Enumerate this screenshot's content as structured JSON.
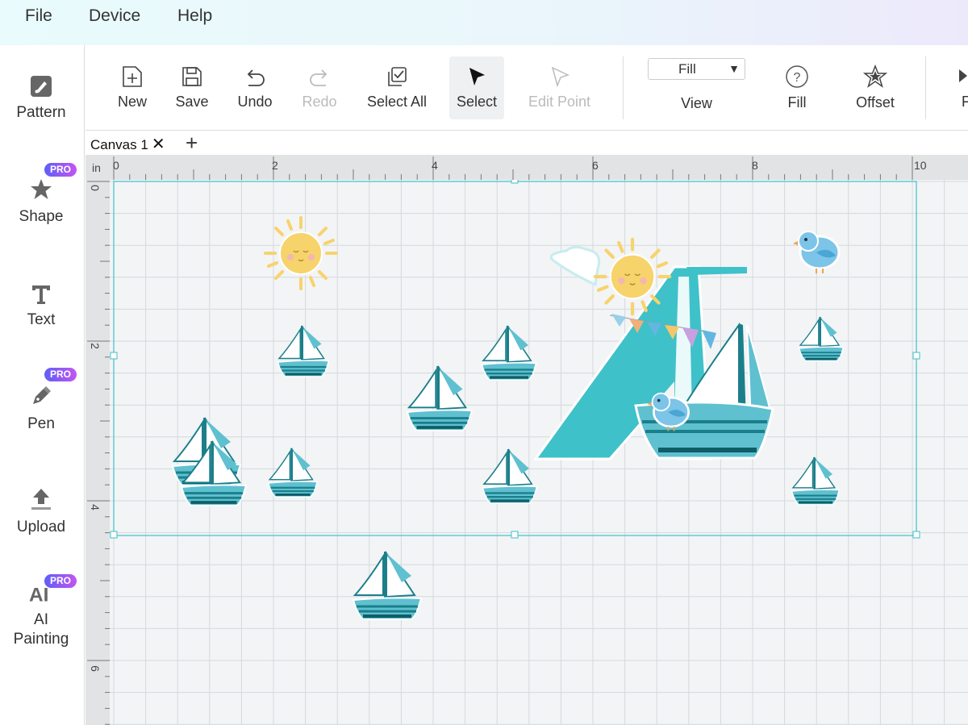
{
  "menu": {
    "file": "File",
    "device": "Device",
    "help": "Help"
  },
  "sidebar": {
    "items": [
      {
        "label": "Pattern",
        "icon": "brush-icon",
        "pro": false
      },
      {
        "label": "Shape",
        "icon": "star-icon",
        "pro": true
      },
      {
        "label": "Text",
        "icon": "text-t-icon",
        "pro": false
      },
      {
        "label": "Pen",
        "icon": "pen-icon",
        "pro": true
      },
      {
        "label": "Upload",
        "icon": "upload-icon",
        "pro": false
      },
      {
        "label": "AI",
        "label2": "Painting",
        "icon": "ai-icon",
        "pro": true
      }
    ],
    "pro_badge": "PRO"
  },
  "toolbar": {
    "new": "New",
    "save": "Save",
    "undo": "Undo",
    "redo": "Redo",
    "select_all": "Select All",
    "select": "Select",
    "edit_point": "Edit Point",
    "view_select_value": "Fill",
    "view_label": "View",
    "fill": "Fill",
    "offset": "Offset",
    "more_partial": "F"
  },
  "tabs": {
    "canvas_tab": "Canvas 1",
    "add": "+"
  },
  "ruler": {
    "unit": "in",
    "top_labels": [
      "0",
      "2",
      "4",
      "6",
      "8",
      "10"
    ],
    "left_labels": [
      "0",
      "2",
      "4",
      "6"
    ]
  },
  "colors": {
    "accent": "#3fc1c9",
    "boat_dark": "#1b7f8a",
    "boat_light": "#5fc0d0",
    "sun": "#f7d36b",
    "grid_bg": "#f2f4f6",
    "grid_line": "#d5d9dc"
  },
  "canvas": {
    "objects": [
      {
        "type": "sailboat"
      },
      {
        "type": "sun"
      },
      {
        "type": "sailboat"
      },
      {
        "type": "sun-cloud"
      },
      {
        "type": "letter-a-boat"
      },
      {
        "type": "bird"
      },
      {
        "type": "sailboat"
      },
      {
        "type": "sailboat"
      }
    ]
  }
}
